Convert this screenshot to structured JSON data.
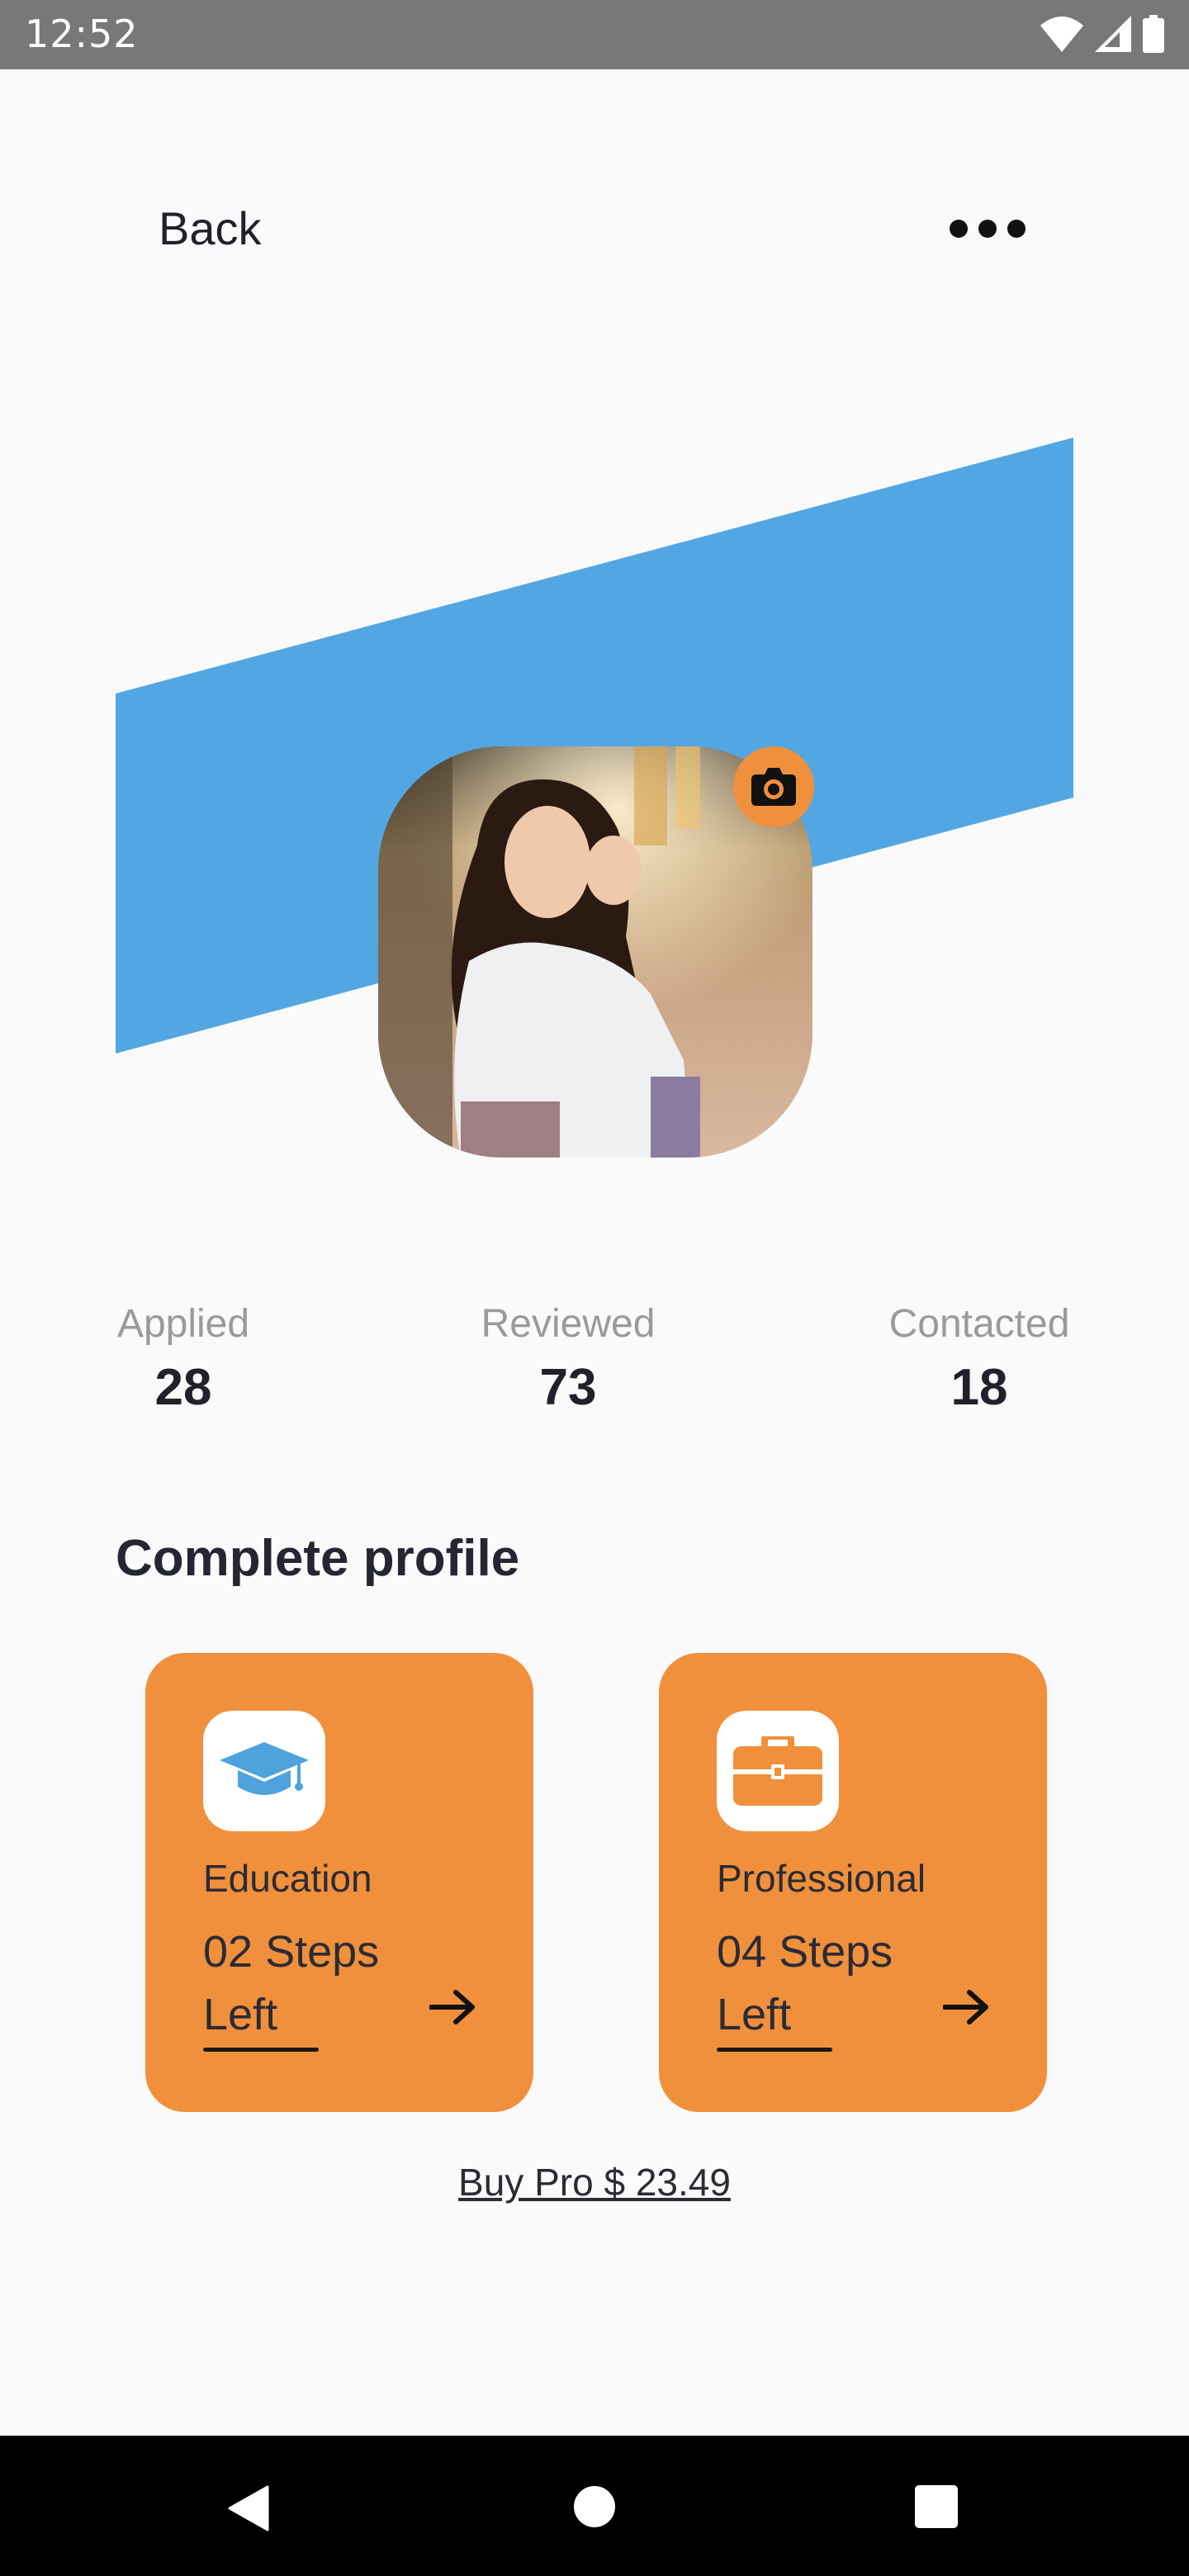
{
  "status_bar": {
    "time": "12:52",
    "icons": [
      "wifi-icon",
      "signal-icon",
      "battery-icon"
    ]
  },
  "header": {
    "back_label": "Back",
    "more_icon": "more-horizontal-icon"
  },
  "profile": {
    "banner_color": "#52a7e2",
    "camera_icon": "camera-icon",
    "camera_button_color": "#f0903d"
  },
  "stats": [
    {
      "label": "Applied",
      "value": "28"
    },
    {
      "label": "Reviewed",
      "value": "73"
    },
    {
      "label": "Contacted",
      "value": "18"
    }
  ],
  "complete_profile": {
    "title": "Complete profile",
    "cards": [
      {
        "icon": "graduation-cap-icon",
        "label": "Education",
        "steps_line1": "02 Steps",
        "steps_line2": "Left",
        "arrow_icon": "arrow-right-icon"
      },
      {
        "icon": "briefcase-icon",
        "label": "Professional",
        "steps_line1": "04 Steps",
        "steps_line2": "Left",
        "arrow_icon": "arrow-right-icon"
      }
    ],
    "card_color": "#f0903d",
    "icon_color": "#4fa3dc",
    "briefcase_color": "#f0903d"
  },
  "buy_pro": {
    "label": "Buy Pro $ 23.49"
  },
  "nav_bar": {
    "buttons": [
      "back-nav-icon",
      "home-nav-icon",
      "recents-nav-icon"
    ]
  }
}
